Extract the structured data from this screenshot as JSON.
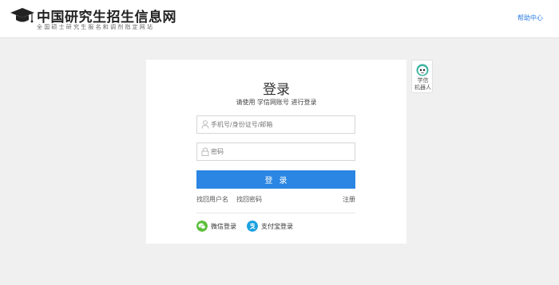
{
  "header": {
    "logo_title": "中国研究生招生信息网",
    "logo_subtitle": "全国硕士研究生报名和调剂指定网站",
    "help_label": "帮助中心"
  },
  "login": {
    "title": "登录",
    "subtitle": "请使用 学信网账号 进行登录",
    "username_placeholder": "手机号/身份证号/邮箱",
    "password_placeholder": "密码",
    "submit_label": "登录",
    "find_username": "找回用户名",
    "find_password": "找回密码",
    "register": "注册",
    "wechat_login": "微信登录",
    "alipay_login": "支付宝登录"
  },
  "robot": {
    "label_line1": "学信",
    "label_line2": "机器人"
  },
  "colors": {
    "accent": "#2a86e2",
    "wechat": "#5bbf3a",
    "alipay": "#1aa0e0"
  },
  "icons": {
    "logo": "graduation-cap-icon",
    "user": "user-icon",
    "lock": "lock-icon",
    "wechat": "wechat-icon",
    "alipay": "alipay-icon",
    "robot": "robot-icon"
  }
}
